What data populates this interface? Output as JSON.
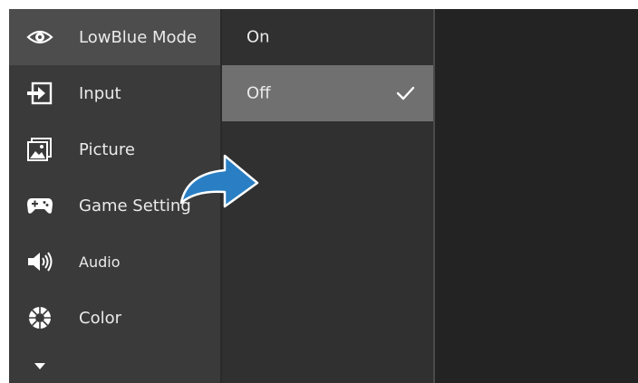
{
  "main_menu": {
    "items": [
      {
        "label": "LowBlue Mode",
        "icon": "eye-icon",
        "selected": true
      },
      {
        "label": "Input",
        "icon": "input-icon",
        "selected": false
      },
      {
        "label": "Picture",
        "icon": "picture-icon",
        "selected": false
      },
      {
        "label": "Game Setting",
        "icon": "gamepad-icon",
        "selected": false
      },
      {
        "label": "Audio",
        "icon": "speaker-icon",
        "selected": false
      },
      {
        "label": "Color",
        "icon": "color-icon",
        "selected": false
      }
    ],
    "more_icon": "chevron-down-icon"
  },
  "submenu": {
    "items": [
      {
        "label": "On",
        "selected": false
      },
      {
        "label": "Off",
        "selected": true,
        "checked": true
      }
    ],
    "check_icon": "checkmark-icon"
  },
  "annotation": {
    "icon": "curved-arrow-icon",
    "color": "#2a7fc4"
  },
  "colors": {
    "menu_bg": "#3a3a3a",
    "menu_selected": "#4d4d4d",
    "submenu_bg": "#303030",
    "submenu_selected": "#707070",
    "text": "#eaeaea"
  }
}
